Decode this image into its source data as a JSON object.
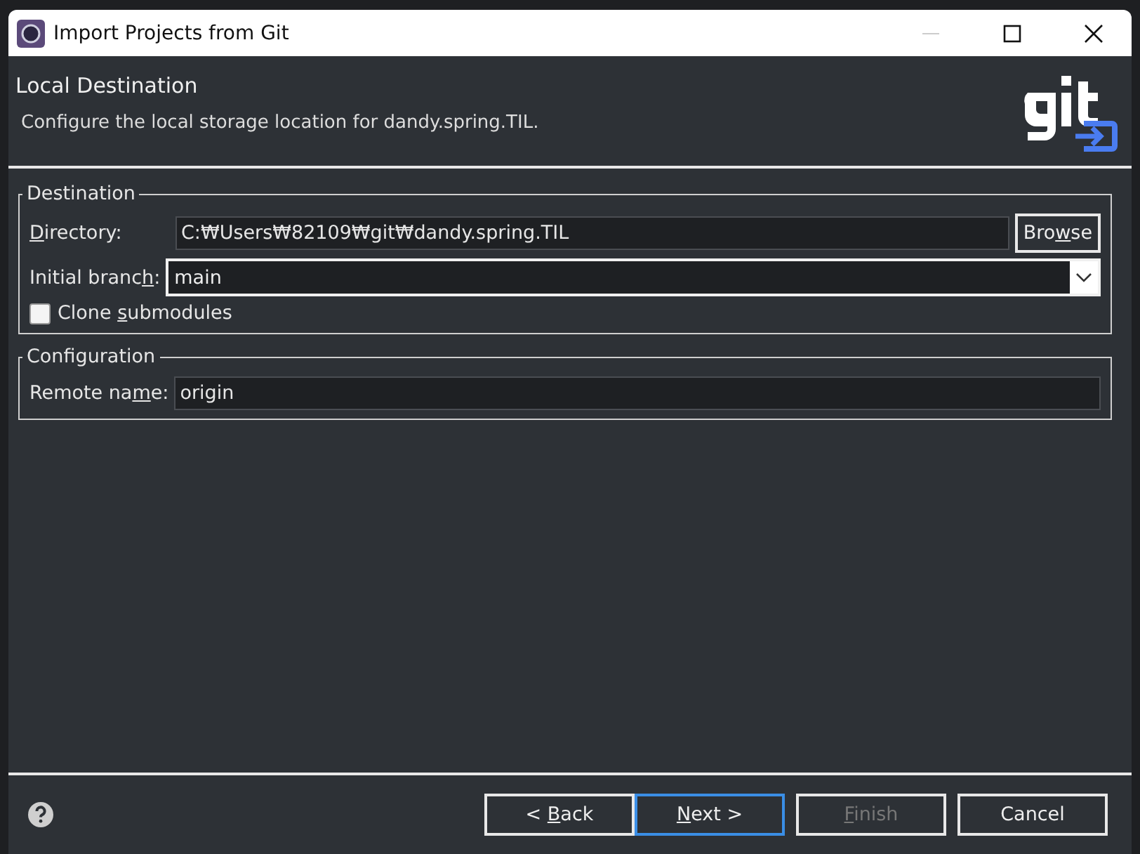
{
  "window": {
    "title": "Import Projects from Git"
  },
  "header": {
    "title": "Local Destination",
    "description": "Configure the local storage location for dandy.spring.TIL."
  },
  "destination": {
    "legend": "Destination",
    "directory": {
      "label": {
        "key": "D",
        "post": "irectory:"
      },
      "value": "C:₩Users₩82109₩git₩dandy.spring.TIL"
    },
    "browse": {
      "pre": "Bro",
      "key": "w",
      "post": "se"
    },
    "branch": {
      "label": {
        "pre": "Initial branc",
        "key": "h",
        "post": ":"
      },
      "value": "main"
    },
    "clone": {
      "label": {
        "pre": "Clone ",
        "key": "s",
        "post": "ubmodules"
      },
      "checked": false
    }
  },
  "configuration": {
    "legend": "Configuration",
    "remote": {
      "label": {
        "pre": "Remote na",
        "key": "m",
        "post": "e:"
      },
      "value": "origin"
    }
  },
  "buttons": [
    {
      "pre": "< ",
      "key": "B",
      "post": "ack",
      "disabled": false,
      "default": false
    },
    {
      "key": "N",
      "post": "ext >",
      "disabled": false,
      "default": true
    },
    {
      "key": "F",
      "post": "inish",
      "disabled": true,
      "default": false
    },
    {
      "post": "Cancel",
      "disabled": false,
      "default": false
    }
  ]
}
